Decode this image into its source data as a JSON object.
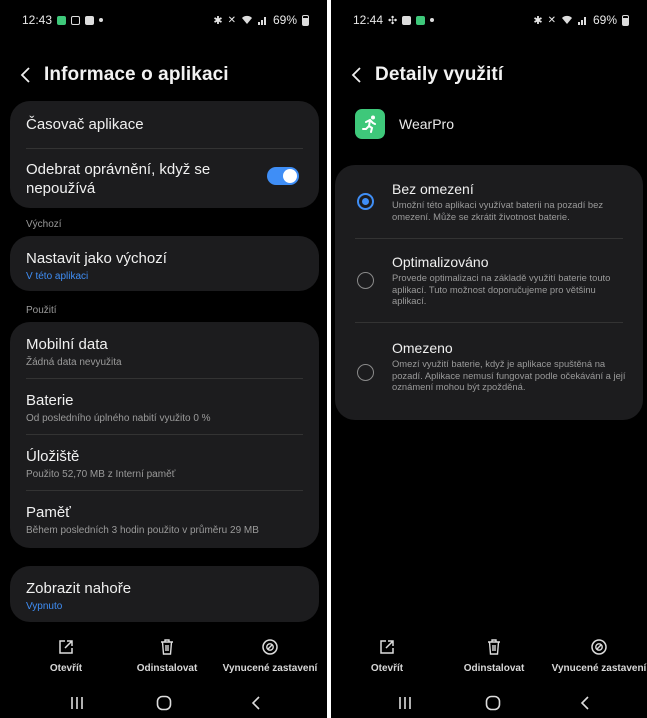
{
  "left": {
    "status": {
      "time": "12:43",
      "battery": "69%"
    },
    "title": "Informace o aplikaci",
    "timer": "Časovač aplikace",
    "remove_permissions": {
      "label": "Odebrat oprávnění, když se nepoužívá",
      "enabled": true
    },
    "section_default": "Výchozí",
    "set_default": {
      "title": "Nastavit jako výchozí",
      "sub": "V této aplikaci"
    },
    "section_usage": "Použití",
    "usage": [
      {
        "title": "Mobilní data",
        "sub": "Žádná data nevyužita"
      },
      {
        "title": "Baterie",
        "sub": "Od posledního úplného nabití využito 0 %"
      },
      {
        "title": "Úložiště",
        "sub": "Použito 52,70 MB z Interní paměť"
      },
      {
        "title": "Paměť",
        "sub": "Během posledních 3 hodin použito v průměru 29 MB"
      }
    ],
    "show_on_top": {
      "title": "Zobrazit nahoře",
      "sub": "Vypnuto"
    },
    "actions": {
      "open": "Otevřít",
      "uninstall": "Odinstalovat",
      "force_stop": "Vynucené zastavení"
    }
  },
  "right": {
    "status": {
      "time": "12:44",
      "battery": "69%"
    },
    "title": "Detaily využití",
    "app_name": "WearPro",
    "options": [
      {
        "title": "Bez omezení",
        "desc": "Umožní této aplikaci využívat baterii na pozadí bez omezení. Může se zkrátit životnost baterie.",
        "selected": true
      },
      {
        "title": "Optimalizováno",
        "desc": "Provede optimalizaci na základě využití baterie touto aplikací. Tuto možnost doporučujeme pro většinu aplikací.",
        "selected": false
      },
      {
        "title": "Omezeno",
        "desc": "Omezí využití baterie, když je aplikace spuštěná na pozadí. Aplikace nemusí fungovat podle očekávání a její oznámení mohou být zpožděná.",
        "selected": false
      }
    ],
    "actions": {
      "open": "Otevřít",
      "uninstall": "Odinstalovat",
      "force_stop": "Vynucené zastavení"
    }
  },
  "colors": {
    "accent": "#3f8ef6",
    "card": "#1c1c1e",
    "app_icon": "#3ec87a"
  },
  "icons": [
    "back-arrow-icon",
    "open-external-icon",
    "trash-icon",
    "stop-circle-icon",
    "recents-icon",
    "home-icon",
    "nav-back-icon",
    "runner-icon"
  ]
}
